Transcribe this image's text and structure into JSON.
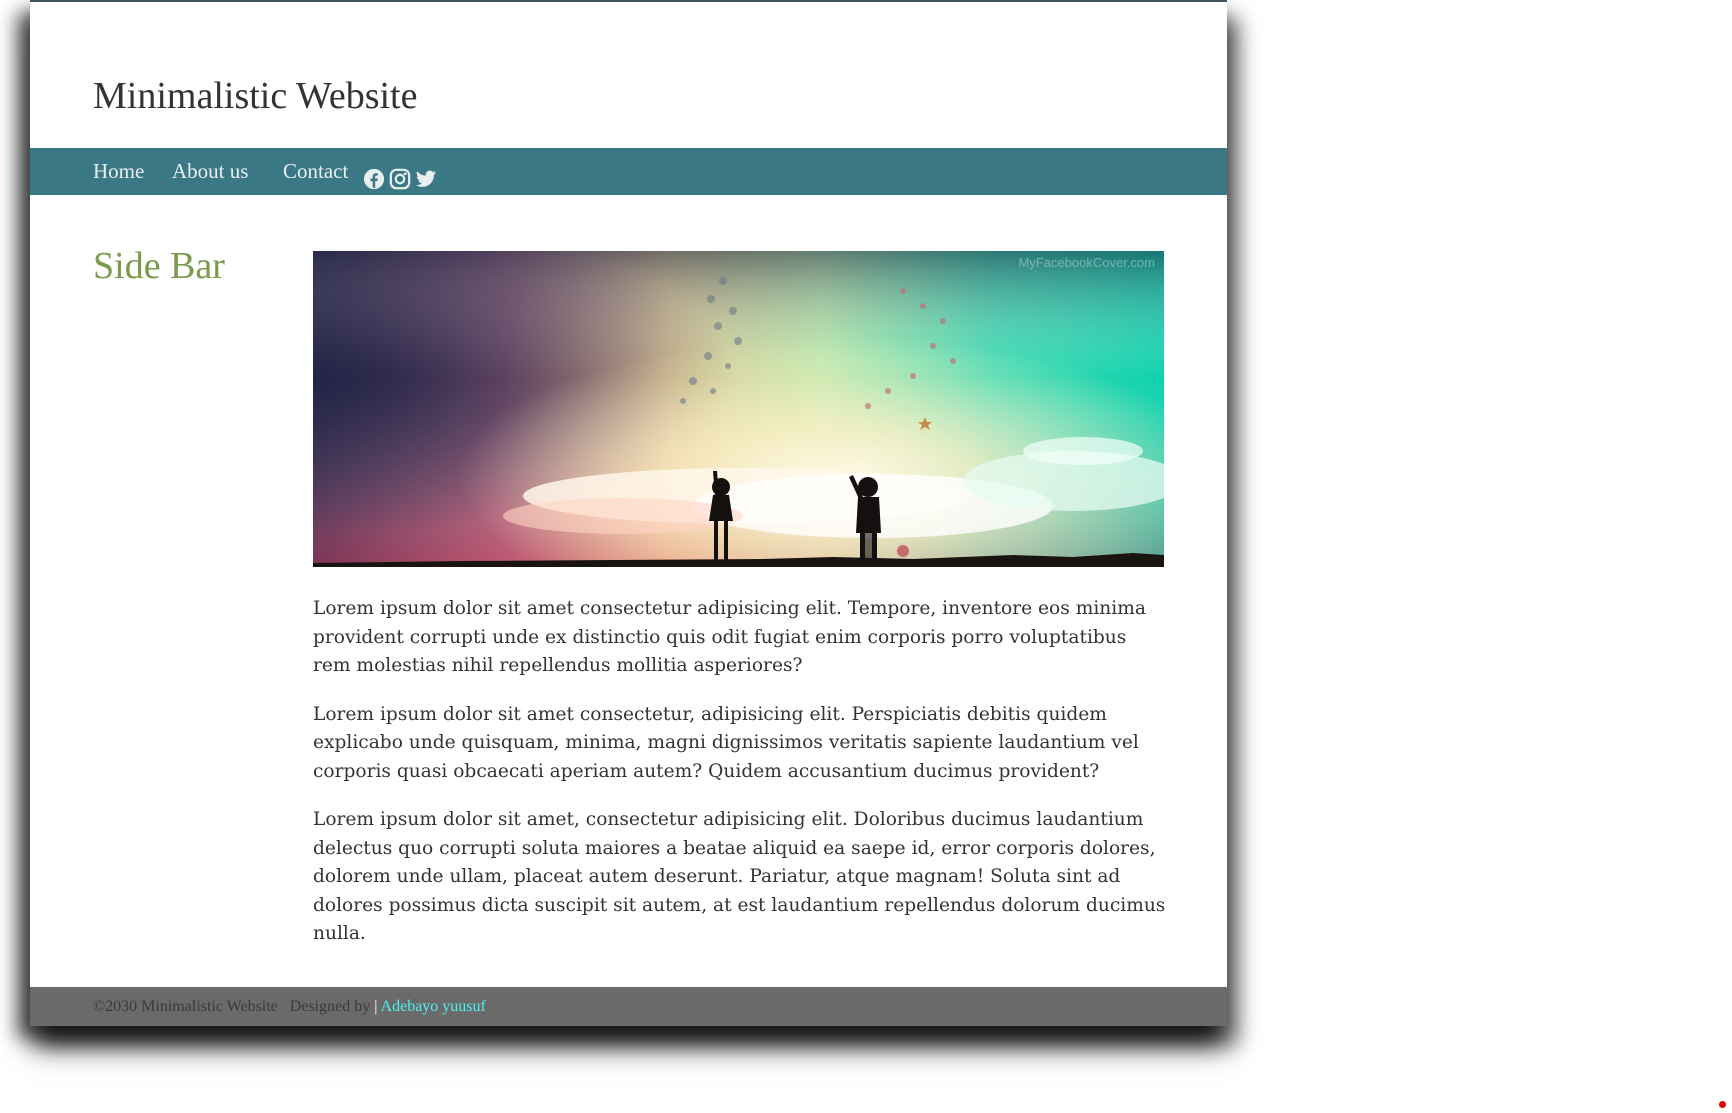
{
  "site": {
    "title": "Minimalistic Website"
  },
  "nav": {
    "items": [
      {
        "label": "Home"
      },
      {
        "label": "About us"
      },
      {
        "label": "Contact"
      }
    ],
    "social_icons": [
      "facebook-icon",
      "instagram-icon",
      "twitter-icon"
    ]
  },
  "sidebar": {
    "title": "Side Bar"
  },
  "hero": {
    "watermark": "MyFacebookCover.com"
  },
  "content": {
    "paragraphs": [
      "Lorem ipsum dolor sit amet consectetur adipisicing elit. Tempore, inventore eos minima provident corrupti unde ex distinctio quis odit fugiat enim corporis porro voluptatibus rem molestias nihil repellendus mollitia asperiores?",
      "Lorem ipsum dolor sit amet consectetur, adipisicing elit. Perspiciatis debitis quidem explicabo unde quisquam, minima, magni dignissimos veritatis sapiente laudantium vel corporis quasi obcaecati aperiam autem? Quidem accusantium ducimus provident?",
      "Lorem ipsum dolor sit amet, consectetur adipisicing elit. Doloribus ducimus laudantium delectus quo corrupti soluta maiores a beatae aliquid ea saepe id, error corporis dolores, dolorem unde ullam, placeat autem deserunt. Pariatur, atque magnam! Soluta sint ad dolores possimus dicta suscipit sit autem, at est laudantium repellendus dolorum ducimus nulla."
    ]
  },
  "footer": {
    "copyright": "©2030 Minimalistic Website   Designed by ",
    "separator": "|",
    "author": " Adebayo yuusuf"
  },
  "colors": {
    "nav_bg": "#3b7886",
    "sidebar_title": "#7a9a4c",
    "footer_bg": "#6a6a6a",
    "author_link": "#4ff0f3"
  }
}
